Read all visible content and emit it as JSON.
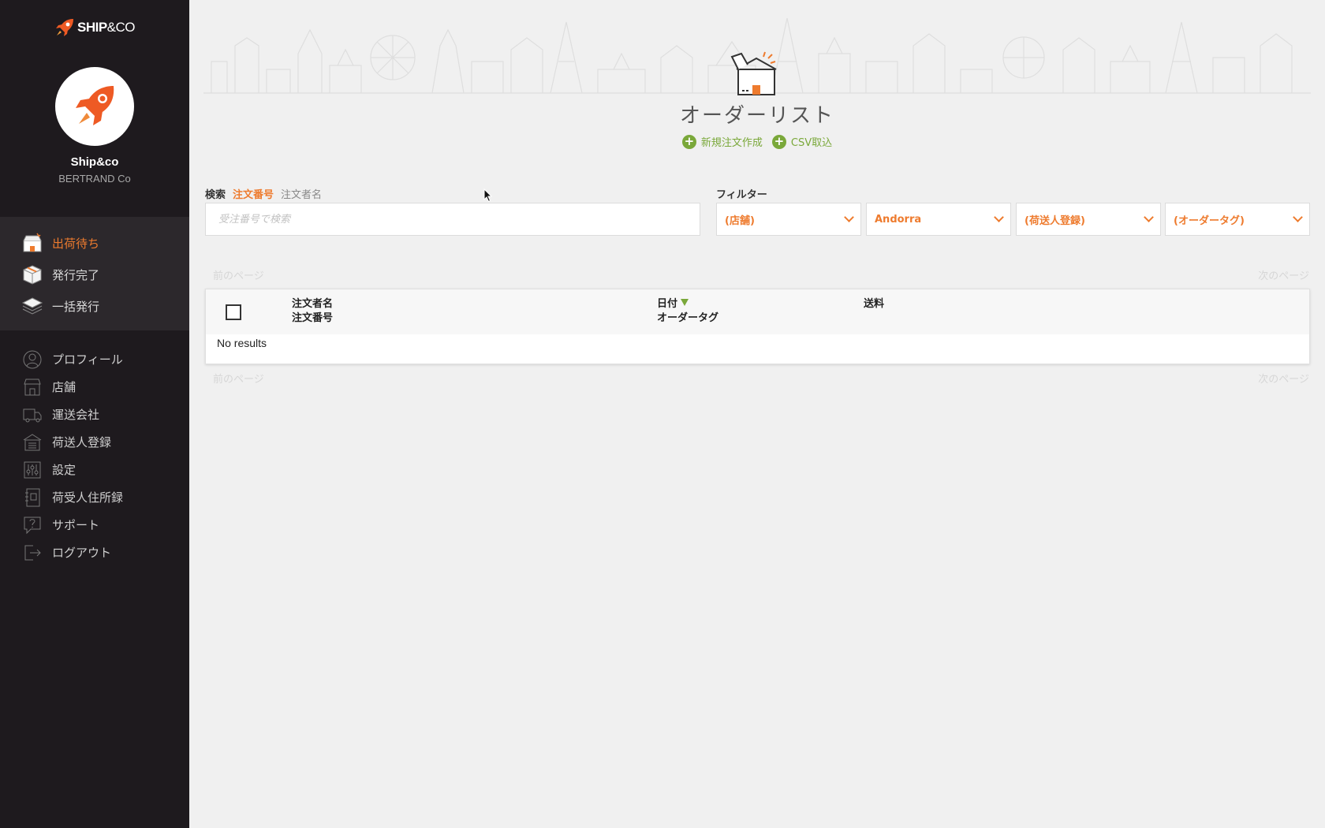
{
  "sidebar": {
    "brand": {
      "main": "SHIP",
      "rest": "&CO"
    },
    "account": {
      "name": "Ship&co",
      "company": "BERTRAND Co"
    },
    "primary_nav": [
      {
        "label": "出荷待ち",
        "icon": "pending-shipment-icon",
        "active": true
      },
      {
        "label": "発行完了",
        "icon": "issued-box-icon",
        "active": false
      },
      {
        "label": "一括発行",
        "icon": "bulk-issue-icon",
        "active": false
      }
    ],
    "secondary_nav": [
      {
        "label": "プロフィール",
        "icon": "profile-icon"
      },
      {
        "label": "店舗",
        "icon": "store-icon"
      },
      {
        "label": "運送会社",
        "icon": "truck-icon"
      },
      {
        "label": "荷送人登録",
        "icon": "warehouse-icon"
      },
      {
        "label": "設定",
        "icon": "settings-sliders-icon"
      },
      {
        "label": "荷受人住所録",
        "icon": "address-book-icon"
      },
      {
        "label": "サポート",
        "icon": "support-icon"
      },
      {
        "label": "ログアウト",
        "icon": "logout-icon"
      }
    ]
  },
  "header": {
    "title": "オーダーリスト",
    "actions": [
      {
        "label": "新規注文作成",
        "icon": "plus-circle-icon"
      },
      {
        "label": "CSV取込",
        "icon": "plus-circle-icon"
      }
    ]
  },
  "search": {
    "label": "検索",
    "tabs": [
      {
        "label": "注文番号",
        "active": true
      },
      {
        "label": "注文者名",
        "active": false
      }
    ],
    "placeholder": "受注番号で検索",
    "value": ""
  },
  "filters": {
    "label": "フィルター",
    "selects": [
      {
        "value": "(店舗)"
      },
      {
        "value": "Andorra"
      },
      {
        "value": "(荷送人登録)"
      },
      {
        "value": "(オーダータグ)"
      }
    ]
  },
  "pagination": {
    "prev": "前のページ",
    "next": "次のページ"
  },
  "table": {
    "columns": [
      {
        "line1": "注文者名",
        "line2": "注文番号"
      },
      {
        "line1": "日付",
        "line2": "オーダータグ",
        "sorted": "desc"
      },
      {
        "line1": "送料",
        "line2": ""
      }
    ],
    "rows": [],
    "empty_text": "No results"
  },
  "colors": {
    "accent": "#ee7b2e",
    "green": "#7aa83a",
    "sidebar_bg": "#1e1a1e"
  }
}
